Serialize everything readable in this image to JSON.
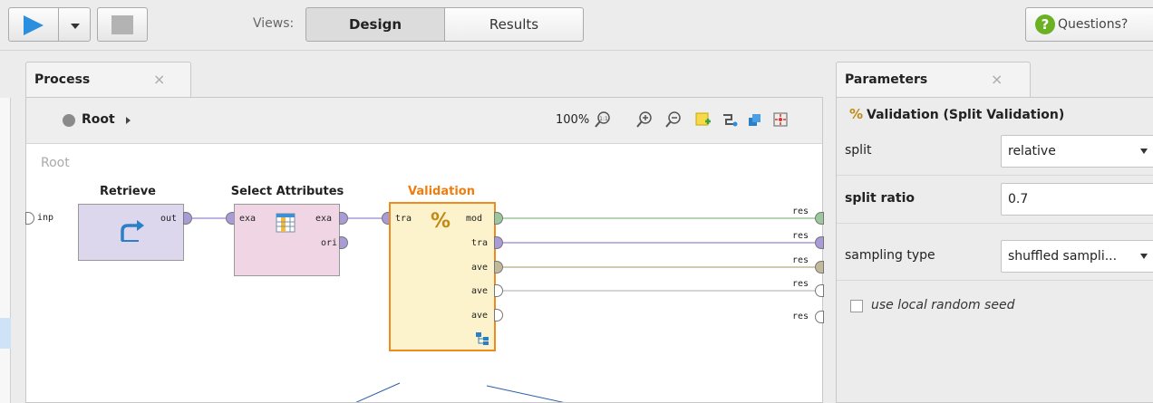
{
  "toolbar": {
    "views_label": "Views:",
    "design_tab": "Design",
    "results_tab": "Results",
    "questions_label": "Questions?",
    "questions_icon_glyph": "?"
  },
  "process_panel": {
    "tab_title": "Process",
    "close_glyph": "×",
    "breadcrumb": "Root",
    "zoom": "100%",
    "canvas_title": "Root",
    "inner_port": "inp",
    "result_ports": [
      "res",
      "res",
      "res",
      "res",
      "res"
    ],
    "operators": {
      "retrieve": {
        "title": "Retrieve",
        "out_port": "out"
      },
      "select_attributes": {
        "title": "Select Attributes",
        "in_port": "exa",
        "out_ports": [
          "exa",
          "ori"
        ]
      },
      "validation": {
        "title": "Validation",
        "in_port": "tra",
        "out_ports": [
          "mod",
          "tra",
          "ave",
          "ave",
          "ave"
        ],
        "icon_glyph": "%"
      }
    }
  },
  "parameters_panel": {
    "tab_title": "Parameters",
    "close_glyph": "×",
    "operator_icon_glyph": "%",
    "operator_title": "Validation (Split Validation)",
    "params": [
      {
        "label": "split",
        "value": "relative",
        "type": "dropdown",
        "bold": false
      },
      {
        "label": "split ratio",
        "value": "0.7",
        "type": "text",
        "bold": true
      },
      {
        "label": "sampling type",
        "value": "shuffled sampli...",
        "type": "dropdown",
        "bold": false
      }
    ],
    "checkbox_label": "use local random seed",
    "checkbox_checked": false
  },
  "colors": {
    "retrieve_fill": "#dcd7ec",
    "select_fill": "#f0d6e5",
    "validation_fill": "#fcf3cc",
    "validation_border": "#f08a1e",
    "validation_title": "#f07d0f",
    "port_example": "#a99ad8",
    "port_model": "#9cc79a",
    "port_performance": "#c2b99a",
    "accent_blue": "#2b8fe0"
  }
}
